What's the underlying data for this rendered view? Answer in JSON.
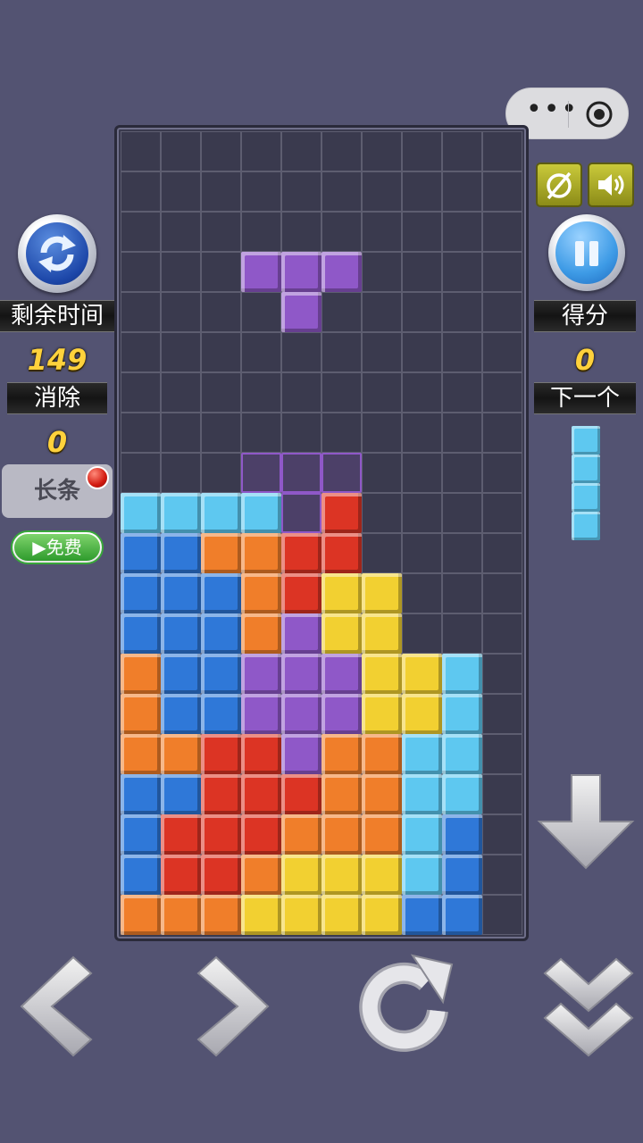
{
  "top_bar": {
    "more_icon": "more-dots-icon",
    "close_icon": "target-circle-icon"
  },
  "left_panel": {
    "refresh_icon": "refresh-icon",
    "time_label": "剩余时间",
    "time_value": "149",
    "clear_label": "消除",
    "clear_value": "0",
    "powerup_label": "长条",
    "free_label": "▶免费"
  },
  "right_panel": {
    "mute_icon": "no-music-icon",
    "sound_icon": "speaker-icon",
    "pause_icon": "pause-icon",
    "score_label": "得分",
    "score_value": "0",
    "next_label": "下一个",
    "next_piece": {
      "type": "I",
      "color": "#5ec8f0",
      "cells": 4
    }
  },
  "board": {
    "cols": 10,
    "rows": 20,
    "colors": {
      "C": "#5ec8f0",
      "B": "#2f78d8",
      "O": "#f07e2a",
      "R": "#dc3424",
      "Y": "#f2d031",
      "P": "#8f58c8"
    },
    "active_piece": {
      "color": "P",
      "cells": [
        [
          3,
          3
        ],
        [
          4,
          3
        ],
        [
          5,
          3
        ],
        [
          4,
          4
        ]
      ]
    },
    "ghost_piece": {
      "color": "P",
      "cells": [
        [
          3,
          8
        ],
        [
          4,
          8
        ],
        [
          5,
          8
        ],
        [
          4,
          9
        ]
      ]
    },
    "grid": [
      "..........",
      "..........",
      "..........",
      "..........",
      "..........",
      "..........",
      "..........",
      "..........",
      "..........",
      "CCCC.R....",
      "BBOORR....",
      "BBBORYY...",
      "BBBOPYY...",
      "OBBPPPYYC.",
      "OBBPPPYYC.",
      "OORRPOOCC.",
      "BBRRROOCC.",
      "BRRROOOCB.",
      "BRROYYYCB.",
      "OOOYYYYBB."
    ]
  },
  "controls": {
    "left_icon": "arrow-left-icon",
    "right_icon": "arrow-right-icon",
    "rotate_icon": "rotate-icon",
    "soft_drop_icon": "arrow-down-icon",
    "hard_drop_icon": "double-chevron-down-icon"
  }
}
